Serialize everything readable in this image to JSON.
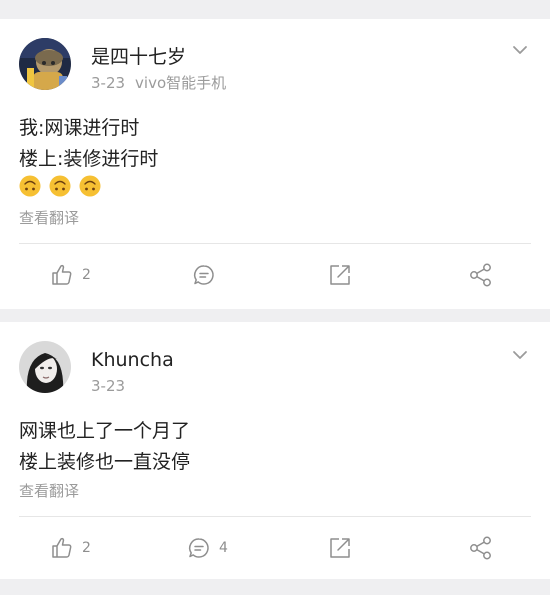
{
  "posts": [
    {
      "username": "是四十七岁",
      "date": "3-23",
      "source": "vivo智能手机",
      "lines": [
        "我:网课进行时",
        "楼上:装修进行时"
      ],
      "emoji": [
        "upside-down-face",
        "upside-down-face",
        "upside-down-face"
      ],
      "translate_label": "查看翻译",
      "like_count": "2",
      "comment_count": "",
      "avatar": "cartoon-character-avatar"
    },
    {
      "username": "Khuncha",
      "date": "3-23",
      "source": "",
      "lines": [
        "网课也上了一个月了",
        "楼上装修也一直没停"
      ],
      "emoji": [],
      "translate_label": "查看翻译",
      "like_count": "2",
      "comment_count": "4",
      "avatar": "portrait-photo-avatar"
    }
  ],
  "colors": {
    "background": "#efeff1",
    "card": "#ffffff",
    "text": "#222222",
    "meta": "#9b9b9b",
    "icon": "#8e8e8e",
    "emoji": "#f6c033"
  }
}
